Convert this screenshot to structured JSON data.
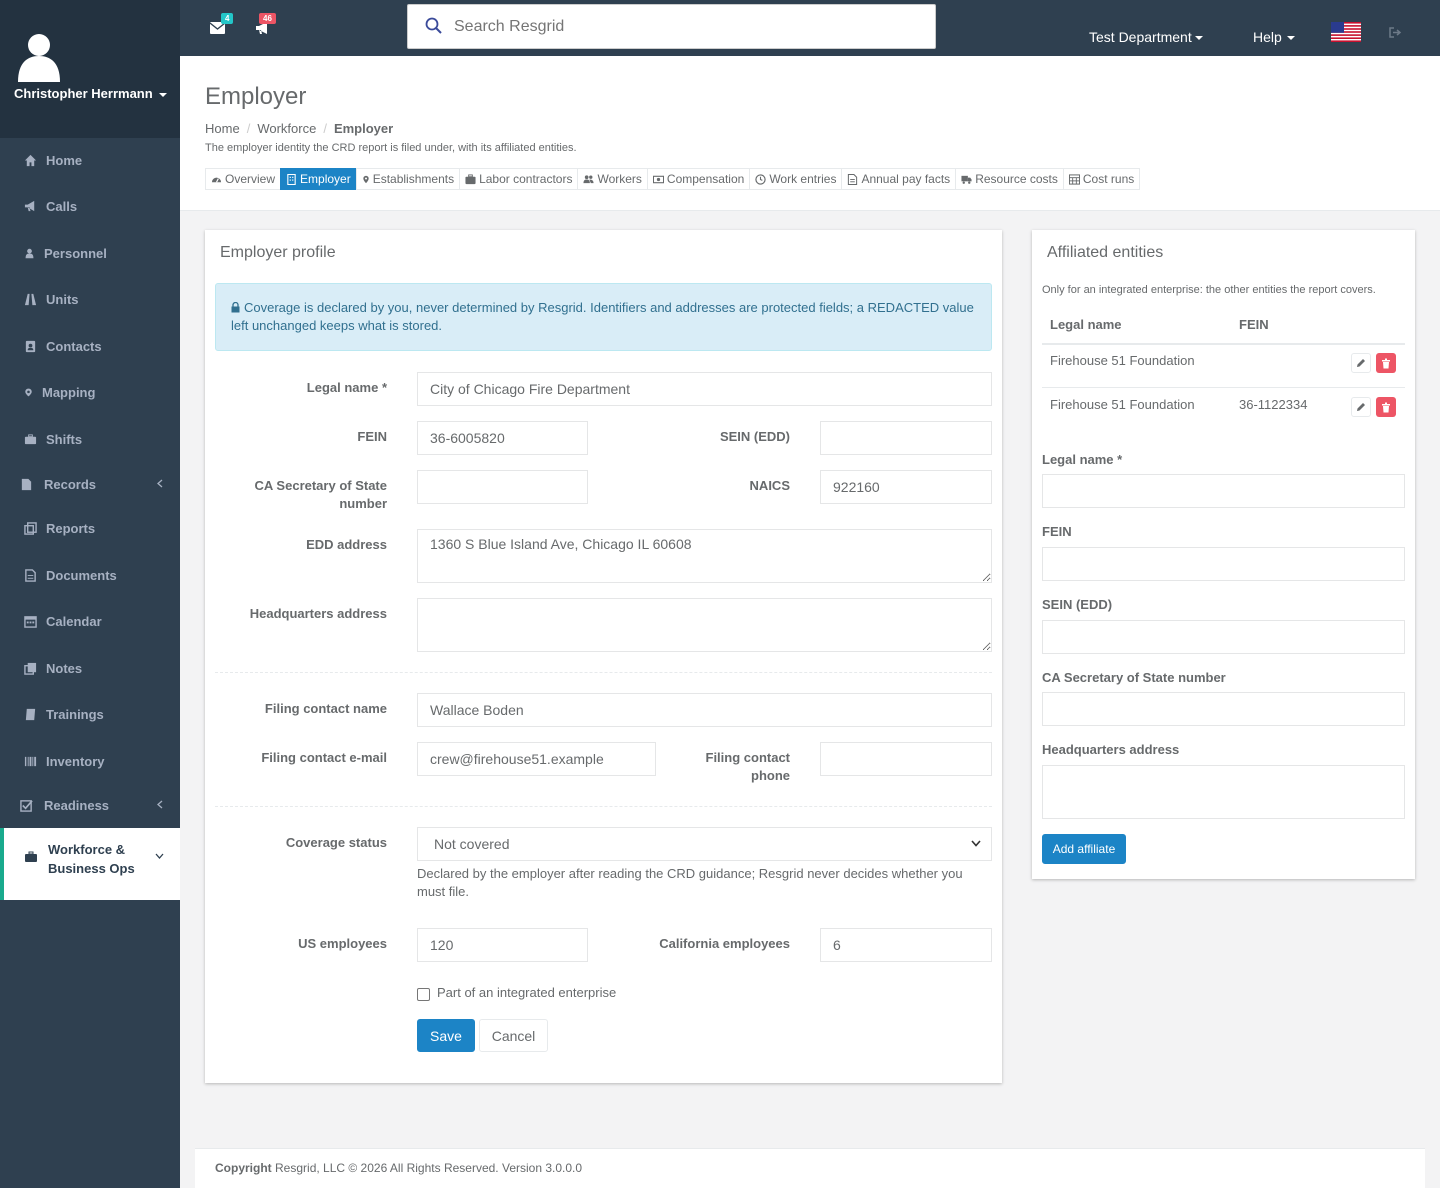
{
  "user": {
    "name": "Christopher Herrmann"
  },
  "nav": {
    "items": [
      {
        "label": "Home",
        "icon": "home-icon"
      },
      {
        "label": "Calls",
        "icon": "bullhorn-icon"
      },
      {
        "label": "Personnel",
        "icon": "user-icon"
      },
      {
        "label": "Units",
        "icon": "road-icon"
      },
      {
        "label": "Contacts",
        "icon": "address-book-icon"
      },
      {
        "label": "Mapping",
        "icon": "map-marker-icon"
      },
      {
        "label": "Shifts",
        "icon": "briefcase-icon"
      },
      {
        "label": "Records",
        "icon": "file-icon"
      },
      {
        "label": "Reports",
        "icon": "report-icon"
      },
      {
        "label": "Documents",
        "icon": "document-icon"
      },
      {
        "label": "Calendar",
        "icon": "calendar-icon"
      },
      {
        "label": "Notes",
        "icon": "notes-icon"
      },
      {
        "label": "Trainings",
        "icon": "book-icon"
      },
      {
        "label": "Inventory",
        "icon": "barcode-icon"
      },
      {
        "label": "Readiness",
        "icon": "check-square-icon"
      }
    ],
    "active": {
      "label": "Workforce & Business Ops",
      "icon": "briefcase-icon"
    }
  },
  "topbar": {
    "messages_count": "4",
    "calls_count": "46",
    "search_placeholder": "Search Resgrid",
    "department": "Test Department",
    "help": "Help"
  },
  "page": {
    "title": "Employer",
    "breadcrumb": [
      "Home",
      "Workforce",
      "Employer"
    ],
    "description": "The employer identity the CRD report is filed under, with its affiliated entities.",
    "tabs": [
      {
        "label": "Overview",
        "icon": "dashboard-icon"
      },
      {
        "label": "Employer",
        "icon": "building-icon"
      },
      {
        "label": "Establishments",
        "icon": "map-marker-icon"
      },
      {
        "label": "Labor contractors",
        "icon": "briefcase-icon"
      },
      {
        "label": "Workers",
        "icon": "users-icon"
      },
      {
        "label": "Compensation",
        "icon": "money-icon"
      },
      {
        "label": "Work entries",
        "icon": "clock-icon"
      },
      {
        "label": "Annual pay facts",
        "icon": "file-text-icon"
      },
      {
        "label": "Resource costs",
        "icon": "truck-icon"
      },
      {
        "label": "Cost runs",
        "icon": "table-icon"
      }
    ]
  },
  "profile": {
    "title": "Employer profile",
    "notice": "Coverage is declared by you, never determined by Resgrid. Identifiers and addresses are protected fields; a REDACTED value left unchanged keeps what is stored.",
    "legal_name_label": "Legal name",
    "legal_name": "City of Chicago Fire Department",
    "fein_label": "FEIN",
    "fein": "36-6005820",
    "sein_label": "SEIN (EDD)",
    "sein": "",
    "sos_label": "CA Secretary of State number",
    "sos": "",
    "naics_label": "NAICS",
    "naics": "922160",
    "edd_address_label": "EDD address",
    "edd_address": "1360 S Blue Island Ave, Chicago IL 60608",
    "hq_address_label": "Headquarters address",
    "hq_address": "",
    "contact_name_label": "Filing contact name",
    "contact_name": "Wallace Boden",
    "contact_email_label": "Filing contact e-mail",
    "contact_email": "crew@firehouse51.example",
    "contact_phone_label": "Filing contact phone",
    "contact_phone": "",
    "coverage_label": "Coverage status",
    "coverage": "Not covered",
    "coverage_help": "Declared by the employer after reading the CRD guidance; Resgrid never decides whether you must file.",
    "us_employees_label": "US employees",
    "us_employees": "120",
    "ca_employees_label": "California employees",
    "ca_employees": "6",
    "integrated_label": "Part of an integrated enterprise",
    "save": "Save",
    "cancel": "Cancel"
  },
  "affiliates": {
    "title": "Affiliated entities",
    "subtitle": "Only for an integrated enterprise: the other entities the report covers.",
    "columns": [
      "Legal name",
      "FEIN"
    ],
    "rows": [
      {
        "name": "Firehouse 51 Foundation",
        "fein": ""
      },
      {
        "name": "Firehouse 51 Foundation",
        "fein": "36-1122334"
      }
    ],
    "form": {
      "legal_name_label": "Legal name",
      "fein_label": "FEIN",
      "sein_label": "SEIN (EDD)",
      "sos_label": "CA Secretary of State number",
      "hq_label": "Headquarters address",
      "add_button": "Add affiliate"
    }
  },
  "footer": {
    "copyright_label": "Copyright",
    "text": "Resgrid, LLC © 2026 All Rights Reserved.",
    "version": "Version 3.0.0.0"
  },
  "colors": {
    "sidebar": "#2f4050",
    "primary": "#1c84c6",
    "danger": "#ed5565",
    "info_bg": "#d9edf7"
  }
}
